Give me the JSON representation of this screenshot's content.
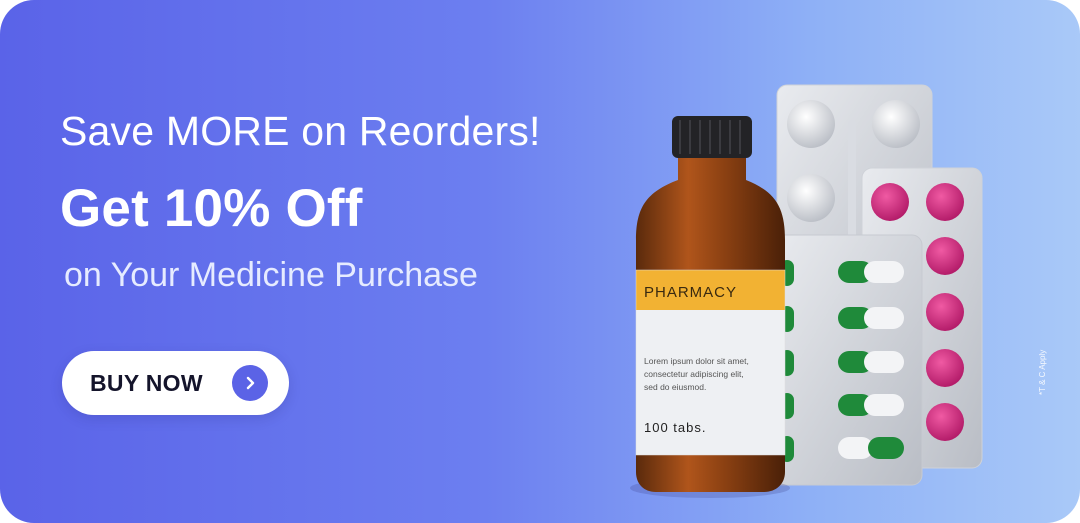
{
  "banner": {
    "headline": "Save MORE on Reorders!",
    "offer": "Get 10% Off",
    "subheading": "on Your Medicine Purchase",
    "cta_label": "BUY NOW",
    "terms": "*T & C Apply"
  },
  "product": {
    "bottle_brand": "PHARMACY",
    "bottle_description_lines": [
      "Lorem ipsum dolor sit amet,",
      "consectetur adipiscing elit,",
      "sed do eiusmod."
    ],
    "bottle_count": "100 tabs."
  },
  "colors": {
    "gradient_start": "#5a63e8",
    "gradient_end": "#a9c9f8",
    "button_bg": "#ffffff",
    "arrow_circle": "#5b63e6",
    "label_band": "#f2b233",
    "capsule_green": "#1f8a3a",
    "tablet_pink": "#d8287f"
  },
  "icons": {
    "cta_arrow": "chevron-right-icon"
  }
}
